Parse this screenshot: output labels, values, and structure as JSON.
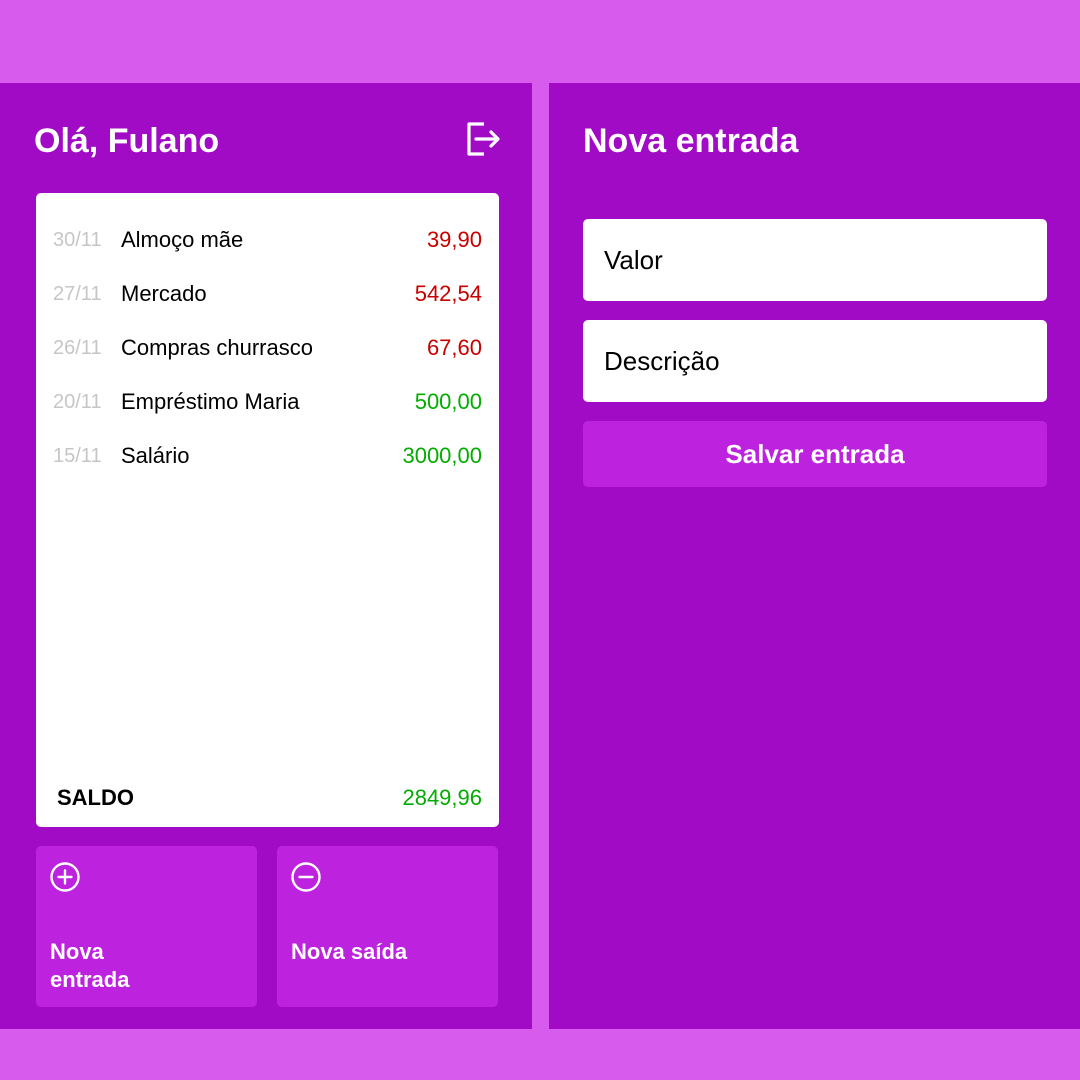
{
  "home": {
    "greeting": "Olá, Fulano",
    "logout_icon": "logout-icon",
    "transactions": [
      {
        "date": "30/11",
        "description": "Almoço mãe",
        "amount": "39,90",
        "type": "expense"
      },
      {
        "date": "27/11",
        "description": "Mercado",
        "amount": "542,54",
        "type": "expense"
      },
      {
        "date": "26/11",
        "description": "Compras churrasco",
        "amount": "67,60",
        "type": "expense"
      },
      {
        "date": "20/11",
        "description": "Empréstimo Maria",
        "amount": "500,00",
        "type": "income"
      },
      {
        "date": "15/11",
        "description": "Salário",
        "amount": "3000,00",
        "type": "income"
      }
    ],
    "balance_label": "SALDO",
    "balance_value": "2849,96",
    "buttons": {
      "income_label": "Nova entrada",
      "income_icon": "plus-circle-icon",
      "expense_label": "Nova saída",
      "expense_icon": "minus-circle-icon"
    }
  },
  "new_entry": {
    "title": "Nova entrada",
    "value_placeholder": "Valor",
    "description_placeholder": "Descrição",
    "save_label": "Salvar entrada"
  },
  "colors": {
    "page_background": "#d75ced",
    "screen_background": "#a10bc6",
    "button_background": "#bd23de",
    "expense": "#c70000",
    "income": "#03ac00",
    "date": "#c6c6c6"
  }
}
